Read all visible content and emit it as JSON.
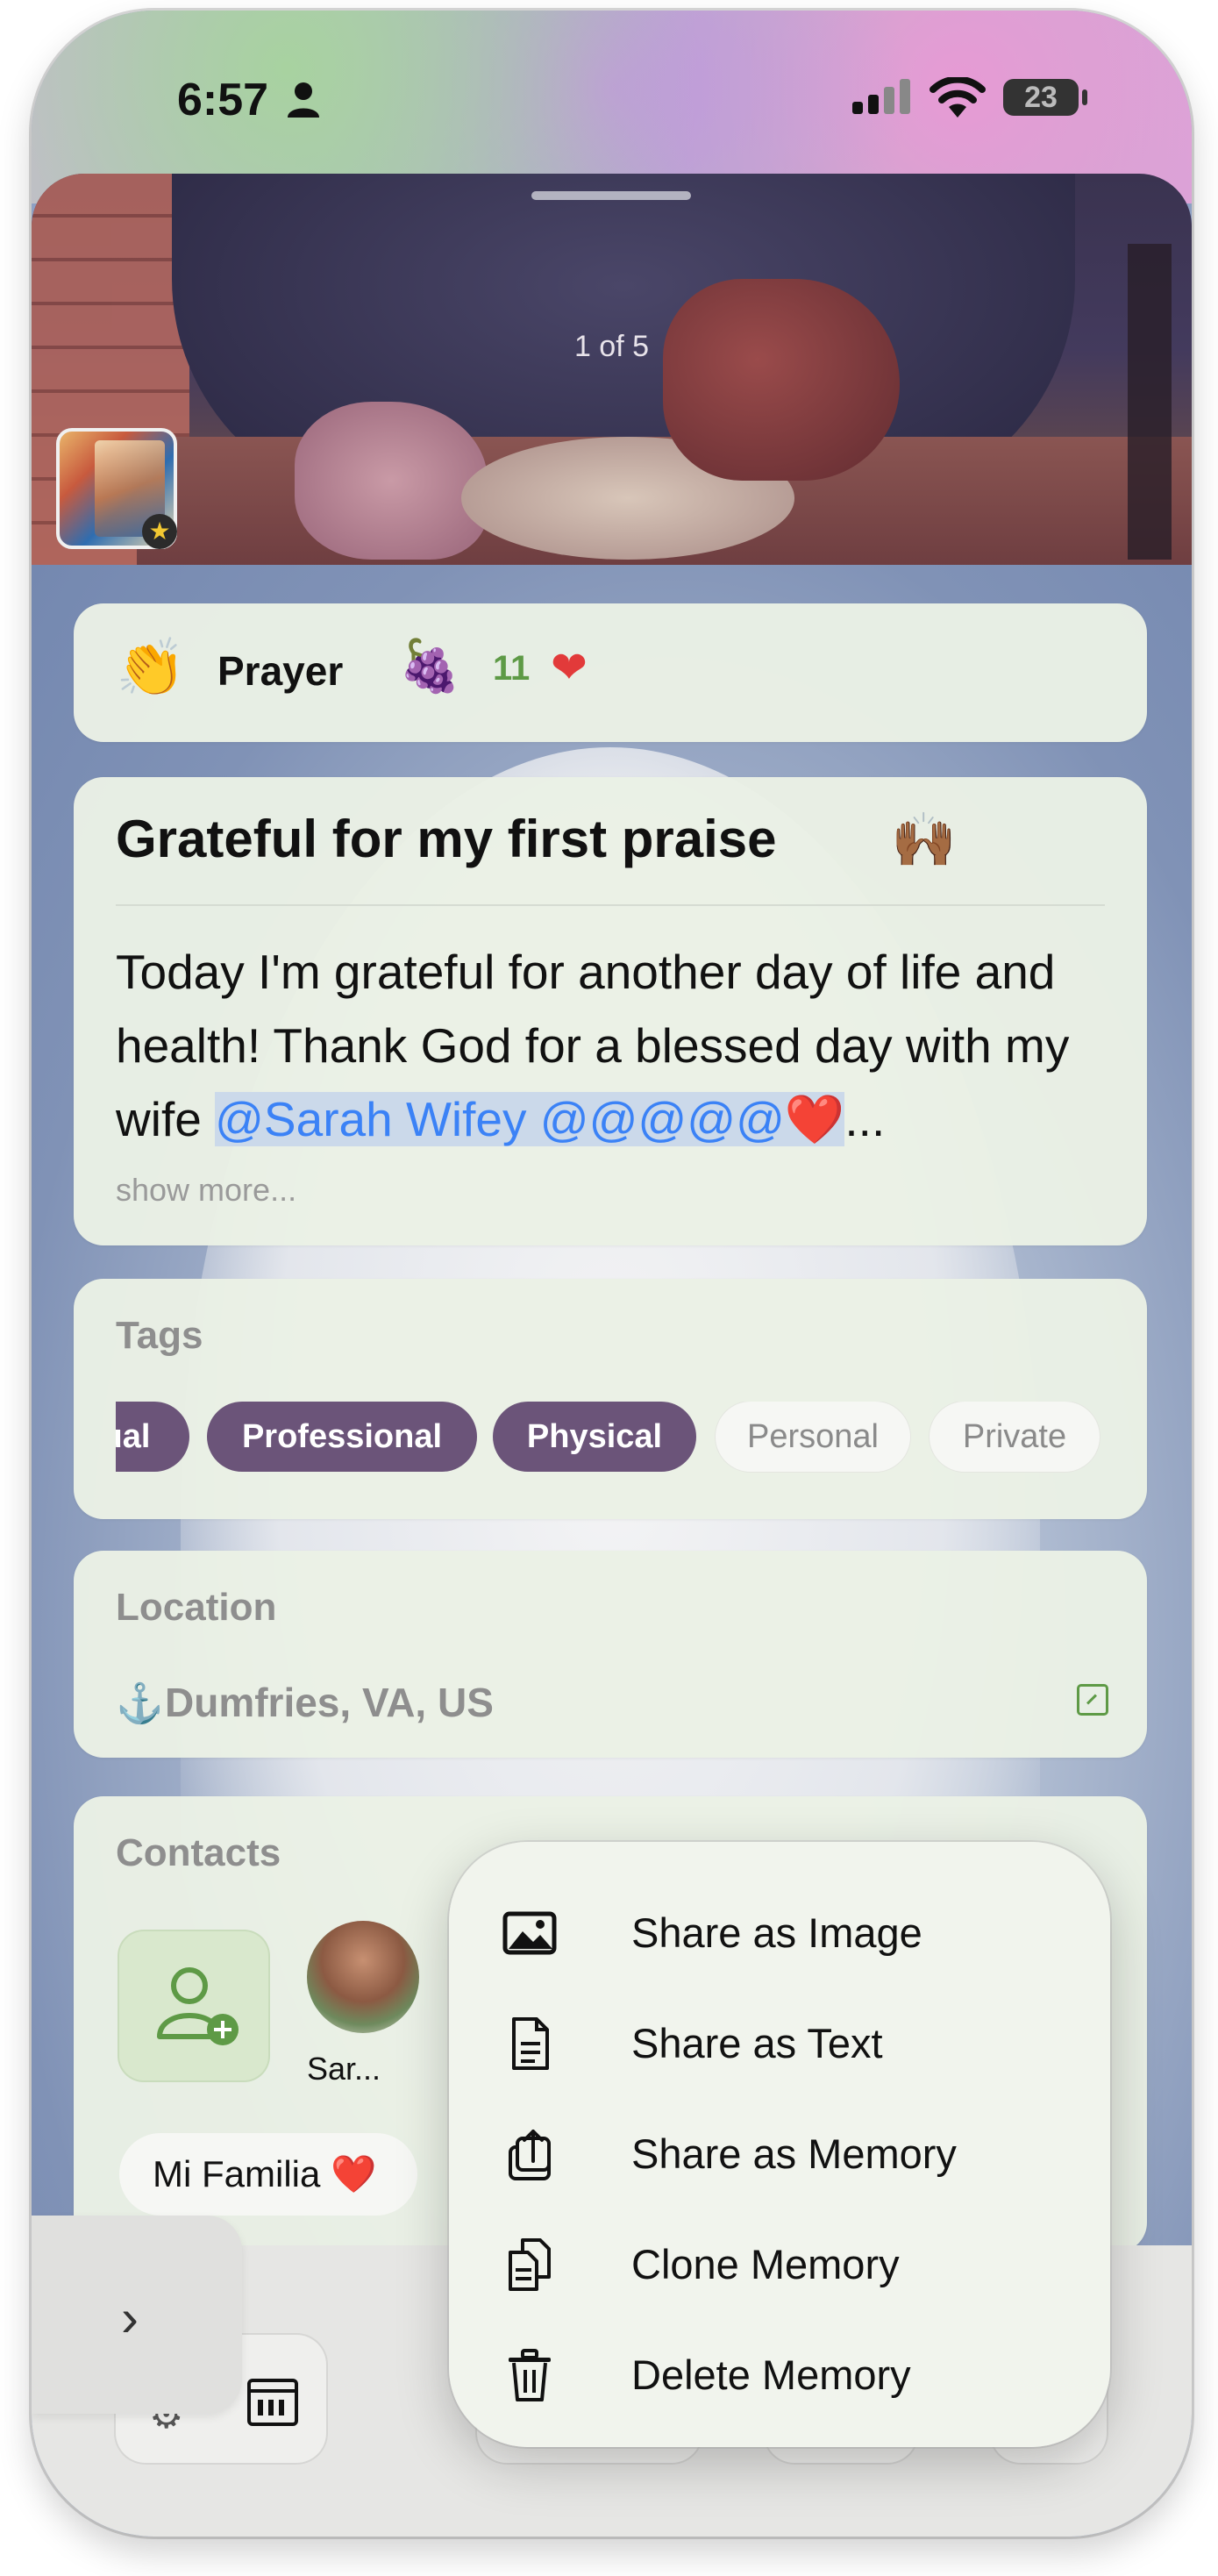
{
  "status_bar": {
    "time": "6:57",
    "battery": "23"
  },
  "photo": {
    "counter": "1 of 5"
  },
  "prayer": {
    "label": "Prayer",
    "count": "11"
  },
  "post": {
    "title": "Grateful for my first praise",
    "title_emoji": "🙌🏾",
    "body_text": "Today I'm grateful for another day of life and health! Thank God for a blessed day with my wife ",
    "mention": "@Sarah Wifey @@@@@",
    "heart": "❤️",
    "ellipsis": "...",
    "show_more": "show more..."
  },
  "tags": {
    "label": "Tags",
    "items": [
      {
        "label": "ual",
        "selected": true
      },
      {
        "label": "Professional",
        "selected": true
      },
      {
        "label": "Physical",
        "selected": true
      },
      {
        "label": "Personal",
        "selected": false
      },
      {
        "label": "Private",
        "selected": false
      }
    ]
  },
  "location": {
    "label": "Location",
    "value": "Dumfries, VA, US"
  },
  "contacts": {
    "label": "Contacts",
    "people": [
      {
        "name": "Sar..."
      }
    ],
    "groups": [
      {
        "label": "Mi Familia ❤️"
      }
    ]
  },
  "menu": {
    "items": [
      {
        "label": "Share as Image",
        "icon": "photo-icon"
      },
      {
        "label": "Share as Text",
        "icon": "document-icon"
      },
      {
        "label": "Share as Memory",
        "icon": "share-icon"
      },
      {
        "label": "Clone Memory",
        "icon": "clone-icon"
      },
      {
        "label": "Delete Memory",
        "icon": "trash-icon"
      }
    ]
  },
  "colors": {
    "accent_green": "#5e9a46",
    "tag_selected": "#6b5479",
    "mention_blue": "#3b82f6",
    "heart_red": "#e23a3a"
  }
}
